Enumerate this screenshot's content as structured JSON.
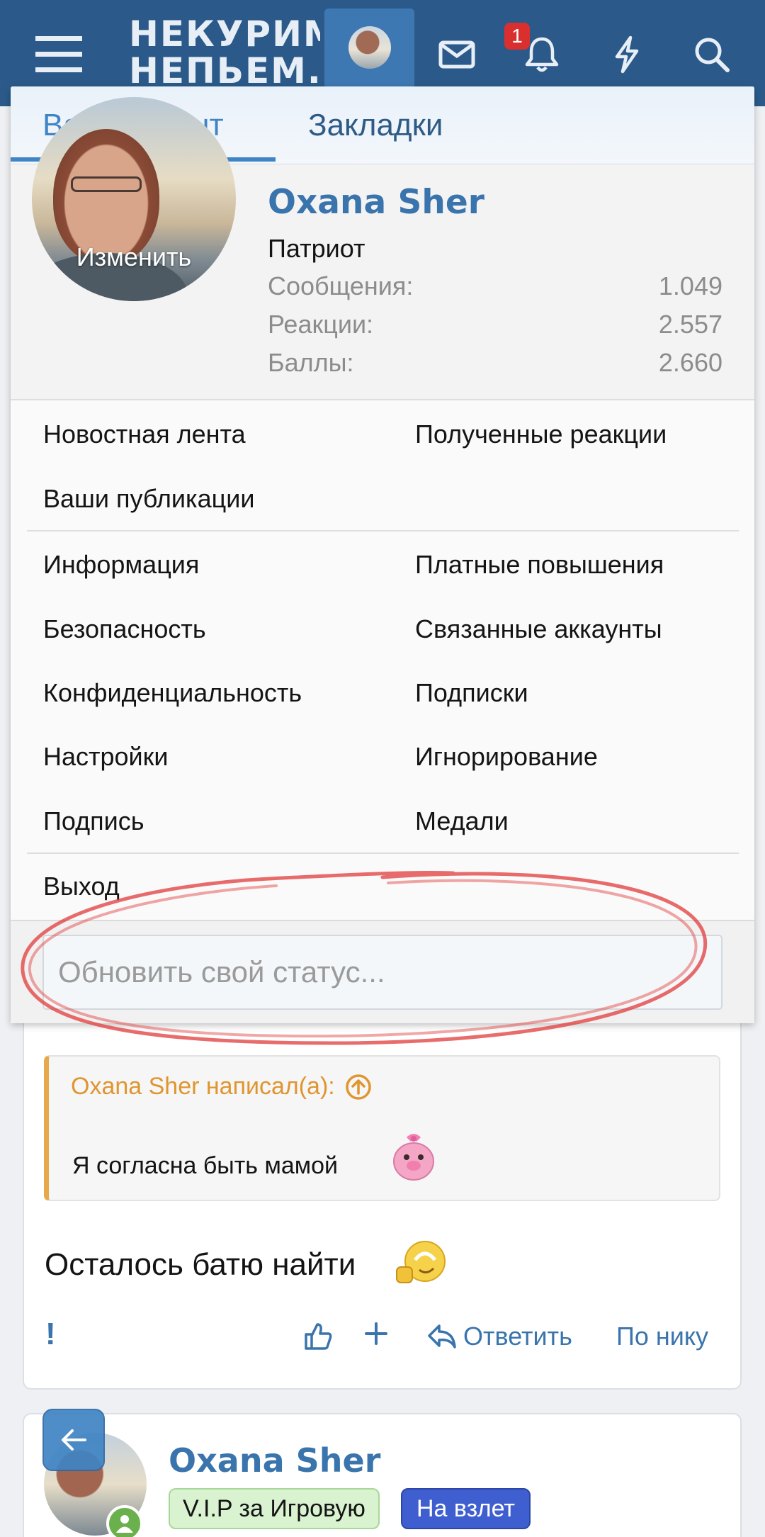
{
  "header": {
    "logo_line1": "НЕКУРИМ",
    "logo_line2": "НЕПЬЕМ...",
    "notification_count": "1",
    "icons": [
      "menu-icon",
      "avatar",
      "mail-icon",
      "bell-icon",
      "bolt-icon",
      "search-icon"
    ],
    "colors": {
      "bar": "#2b5a8a",
      "active_tab": "#3e78b2",
      "badge": "#d9302f"
    }
  },
  "popup": {
    "tabs": [
      {
        "label": "Ваш аккаунт",
        "active": true
      },
      {
        "label": "Закладки",
        "active": false
      }
    ],
    "profile": {
      "avatar_action": "Изменить",
      "name": "Oxana Sher",
      "title": "Патриот",
      "stats": [
        {
          "label": "Сообщения:",
          "value": "1.049"
        },
        {
          "label": "Реакции:",
          "value": "2.557"
        },
        {
          "label": "Баллы:",
          "value": "2.660"
        }
      ]
    },
    "links_group1": {
      "left": [
        "Новостная лента",
        "Ваши публикации"
      ],
      "right": [
        "Полученные реакции"
      ]
    },
    "links_group2": {
      "left": [
        "Информация",
        "Безопасность",
        "Конфиденциальность",
        "Настройки",
        "Подпись"
      ],
      "right": [
        "Платные повышения",
        "Связанные аккаунты",
        "Подписки",
        "Игнорирование",
        "Медали"
      ]
    },
    "logout": "Выход",
    "status_placeholder": "Обновить свой статус..."
  },
  "post": {
    "quote_author": "Oxana Sher написал(а):",
    "quote_text": "Я согласна быть мамой",
    "text": "Осталось батю найти",
    "actions": {
      "reply": "Ответить",
      "by_nick": "По нику"
    }
  },
  "next_post": {
    "name": "Oxana Sher",
    "badges": [
      "V.I.P за Игровую",
      "На взлет"
    ]
  }
}
